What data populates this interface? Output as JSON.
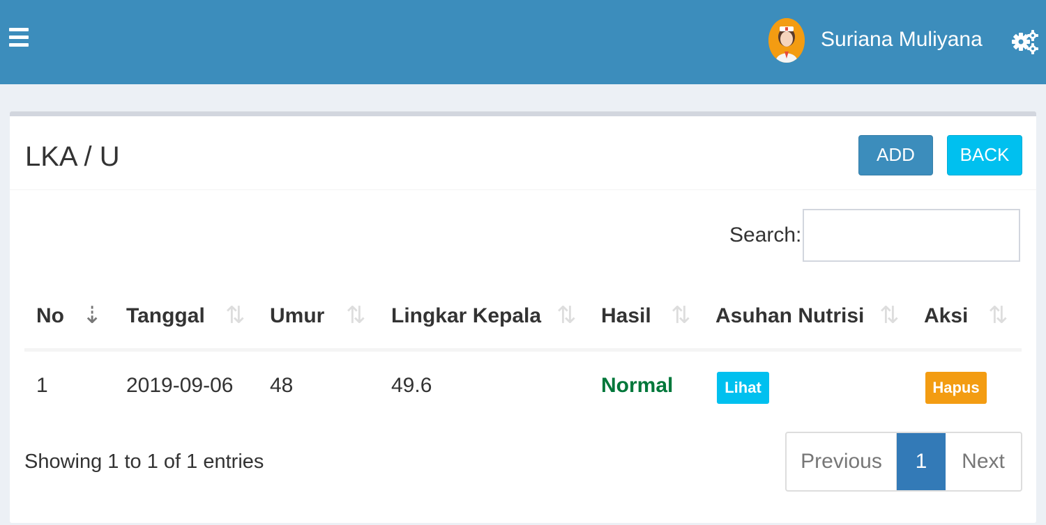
{
  "header": {
    "user_name": "Suriana Muliyana",
    "menu_icon": "hamburger-icon",
    "settings_icon": "gears-icon",
    "color": "#3c8dbc"
  },
  "box": {
    "title": "LKA / U",
    "add_label": "ADD",
    "back_label": "BACK"
  },
  "search": {
    "label": "Search:",
    "value": ""
  },
  "table": {
    "columns": [
      "No",
      "Tanggal",
      "Umur",
      "Lingkar Kepala",
      "Hasil",
      "Asuhan Nutrisi",
      "Aksi"
    ],
    "rows": [
      {
        "no": "1",
        "tanggal": "2019-09-06",
        "umur": "48",
        "lingkar_kepala": "49.6",
        "hasil": "Normal",
        "asuhan_nutrisi": "Lihat",
        "aksi": "Hapus"
      }
    ]
  },
  "footer": {
    "info": "Showing 1 to 1 of 1 entries",
    "previous": "Previous",
    "page": "1",
    "next": "Next"
  }
}
